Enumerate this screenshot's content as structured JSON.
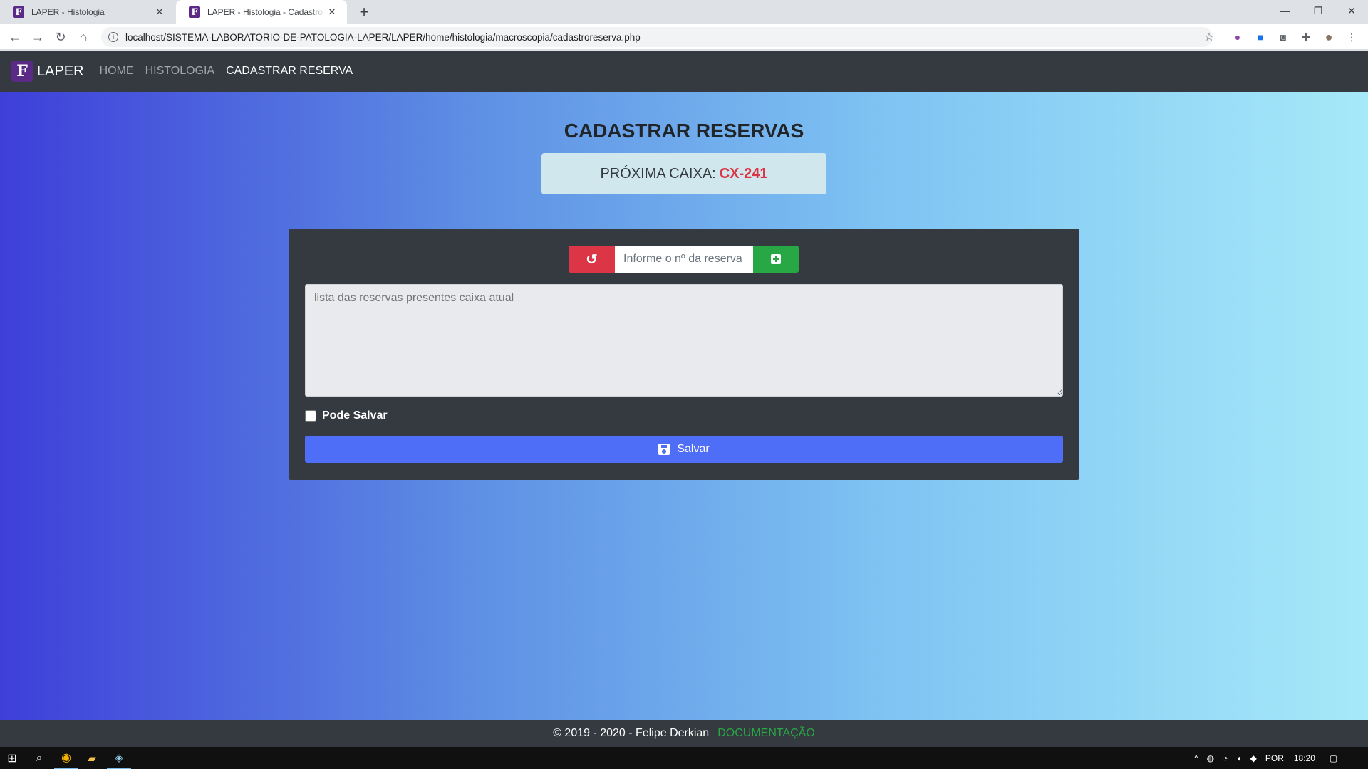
{
  "browser": {
    "tabs": [
      {
        "title": "LAPER - Histologia",
        "favicon": "F"
      },
      {
        "title": "LAPER - Histologia - Cadastro de Reservas",
        "favicon": "F"
      }
    ],
    "url": "localhost/SISTEMA-LABORATORIO-DE-PATOLOGIA-LAPER/LAPER/home/histologia/macroscopia/cadastroreserva.php"
  },
  "navbar": {
    "brand": "LAPER",
    "brand_logo": "F",
    "links": [
      "HOME",
      "HISTOLOGIA",
      "CADASTRAR RESERVA"
    ]
  },
  "main": {
    "title": "CADASTRAR RESERVAS",
    "next_box_label": "PRÓXIMA CAIXA:",
    "next_box_code": "CX-241",
    "reserve_input_placeholder": "Informe o nº da reserva",
    "list_placeholder": "lista das reservas presentes caixa atual",
    "checkbox_label": "Pode Salvar",
    "save_label": "Salvar"
  },
  "footer": {
    "copyright": "© 2019 - 2020 - Felipe Derkian",
    "doc_link": "DOCUMENTAÇÃO"
  },
  "taskbar": {
    "language": "POR",
    "time": "18:20"
  },
  "colors": {
    "navbar": "#343a40",
    "danger": "#dc3545",
    "success": "#28a745",
    "primary": "#4f6ef7",
    "brand": "#5b2a86"
  }
}
